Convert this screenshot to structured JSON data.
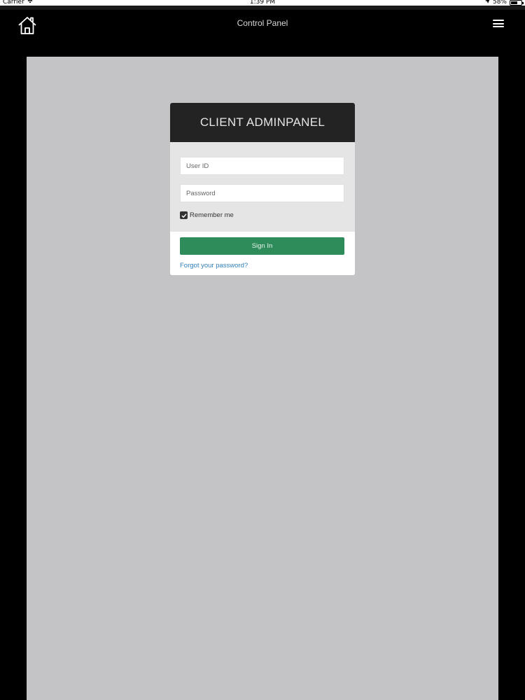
{
  "status_bar": {
    "carrier": "Carrier",
    "time": "1:39 PM",
    "battery": "58%"
  },
  "navbar": {
    "title": "Control Panel",
    "home_icon": "home-icon",
    "menu_icon": "hamburger-menu-icon"
  },
  "login": {
    "header_title": "CLIENT ADMINPANEL",
    "user_id_placeholder": "User ID",
    "password_placeholder": "Password",
    "remember_label": "Remember me",
    "remember_checked": true,
    "signin_label": "Sign In",
    "forgot_label": "Forgot your password?"
  },
  "colors": {
    "background": "#000000",
    "content_panel": "#c4c3c6",
    "card_header": "#232323",
    "card_body": "#e5e5e6",
    "signin_button": "#2e8b5a",
    "link": "#2f7fb8"
  }
}
